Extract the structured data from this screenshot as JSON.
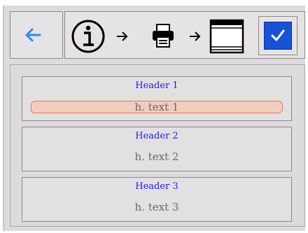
{
  "toolbar": {
    "back_icon": "left-arrow-icon",
    "chain_icons": [
      "info-icon",
      "right-arrow-icon",
      "printer-icon",
      "right-arrow-icon",
      "window-icon"
    ],
    "checkbox_checked": true
  },
  "sections": [
    {
      "header": "Header 1",
      "text": "h. text 1",
      "focused": true
    },
    {
      "header": "Header 2",
      "text": "h. text 2",
      "focused": false
    },
    {
      "header": "Header 3",
      "text": "h. text 3",
      "focused": false
    }
  ],
  "colors": {
    "accent": "#1a52d6",
    "header_text": "#1c1ce6",
    "focus_fill": "#f1cdbf",
    "focus_border": "#e07a58",
    "back_arrow": "#2a8cf0"
  }
}
